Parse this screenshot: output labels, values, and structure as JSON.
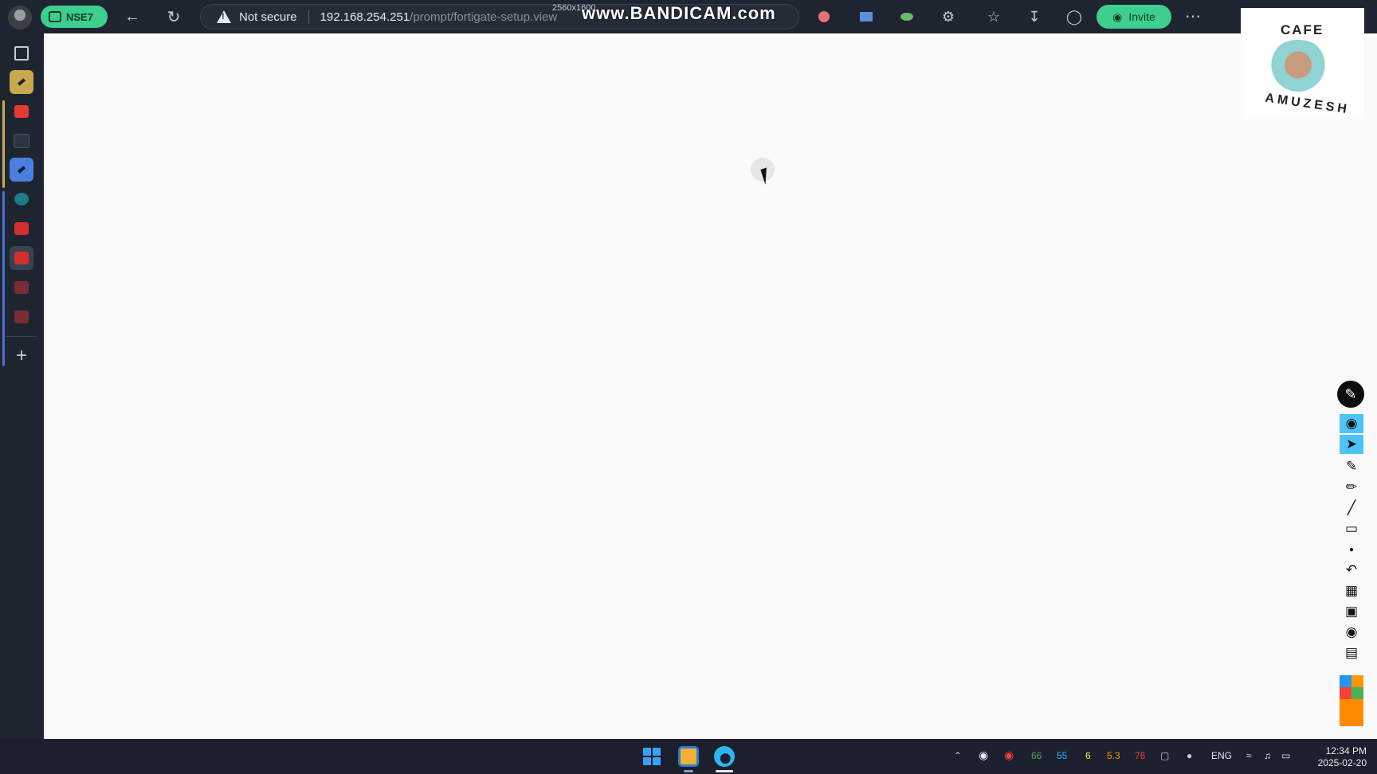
{
  "browser": {
    "workspace_label": "NSE7",
    "address": {
      "security_label": "Not secure",
      "host": "192.168.254.251",
      "path": "/prompt/fortigate-setup.view"
    },
    "invite_label": "Invite",
    "more_label": "⋯"
  },
  "recorder": {
    "watermark": "www.BANDICAM.com",
    "resolution": "2560x1600"
  },
  "logo": {
    "top_text": "CAFE",
    "bottom_text": "AMUZESH"
  },
  "taskbar": {
    "tray": {
      "values": [
        "66",
        "55",
        "6",
        "5.3",
        "76"
      ],
      "value_colors": [
        "#4caf50",
        "#29b6f6",
        "#ffeb3b",
        "#ff9800",
        "#f44336"
      ],
      "language": "ENG"
    },
    "clock": {
      "time": "12:34 PM",
      "date": "2025-02-20"
    }
  },
  "colors": {
    "accent_green": "#3ecf8e",
    "chrome_bg": "#1f2530",
    "page_bg": "#fafafa",
    "draw_active": "#4fc3f7"
  }
}
